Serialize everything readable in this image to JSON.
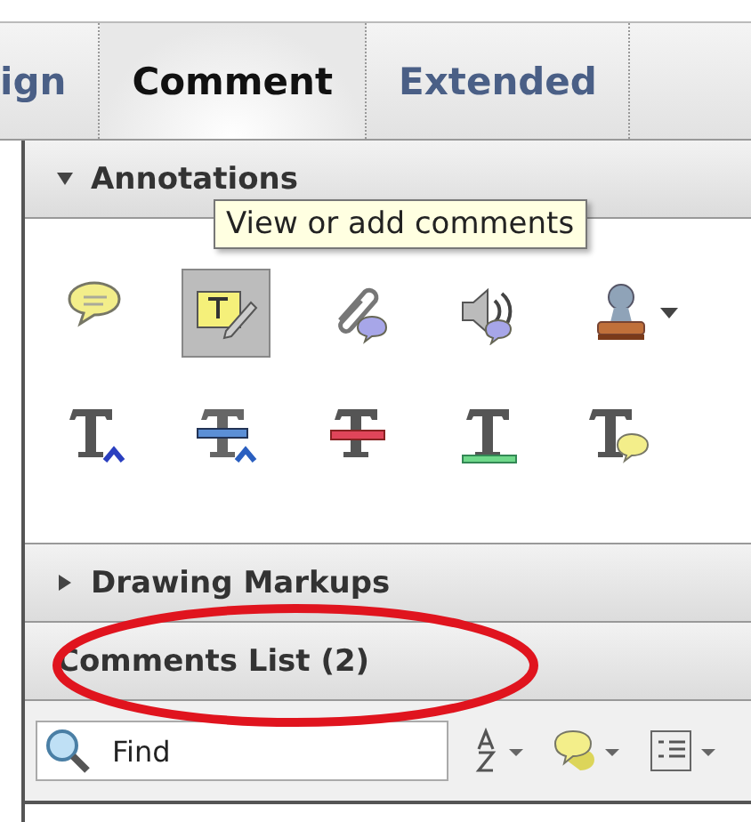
{
  "tabs": [
    {
      "label": "ign",
      "selected": false
    },
    {
      "label": "Comment",
      "selected": true
    },
    {
      "label": "Extended",
      "selected": false
    }
  ],
  "tooltip": "View or add comments",
  "sections": [
    {
      "title": "Annotations",
      "expanded": true,
      "tools": [
        {
          "kind": "note",
          "selected": false,
          "has_menu": false
        },
        {
          "kind": "text-edit",
          "selected": true,
          "has_menu": false
        },
        {
          "kind": "attach",
          "selected": false,
          "has_menu": false
        },
        {
          "kind": "audio",
          "selected": false,
          "has_menu": false
        },
        {
          "kind": "stamp",
          "selected": false,
          "has_menu": true
        },
        {
          "kind": "insert-text",
          "selected": false,
          "has_menu": false
        },
        {
          "kind": "replace-text",
          "selected": false,
          "has_menu": false
        },
        {
          "kind": "strikethrough",
          "selected": false,
          "has_menu": false
        },
        {
          "kind": "underline",
          "selected": false,
          "has_menu": false
        },
        {
          "kind": "text-note",
          "selected": false,
          "has_menu": false
        }
      ]
    },
    {
      "title": "Drawing Markups",
      "expanded": false
    }
  ],
  "comments_list": {
    "title": "Comments List (2)",
    "circled": true,
    "search": {
      "placeholder": "Find"
    }
  }
}
